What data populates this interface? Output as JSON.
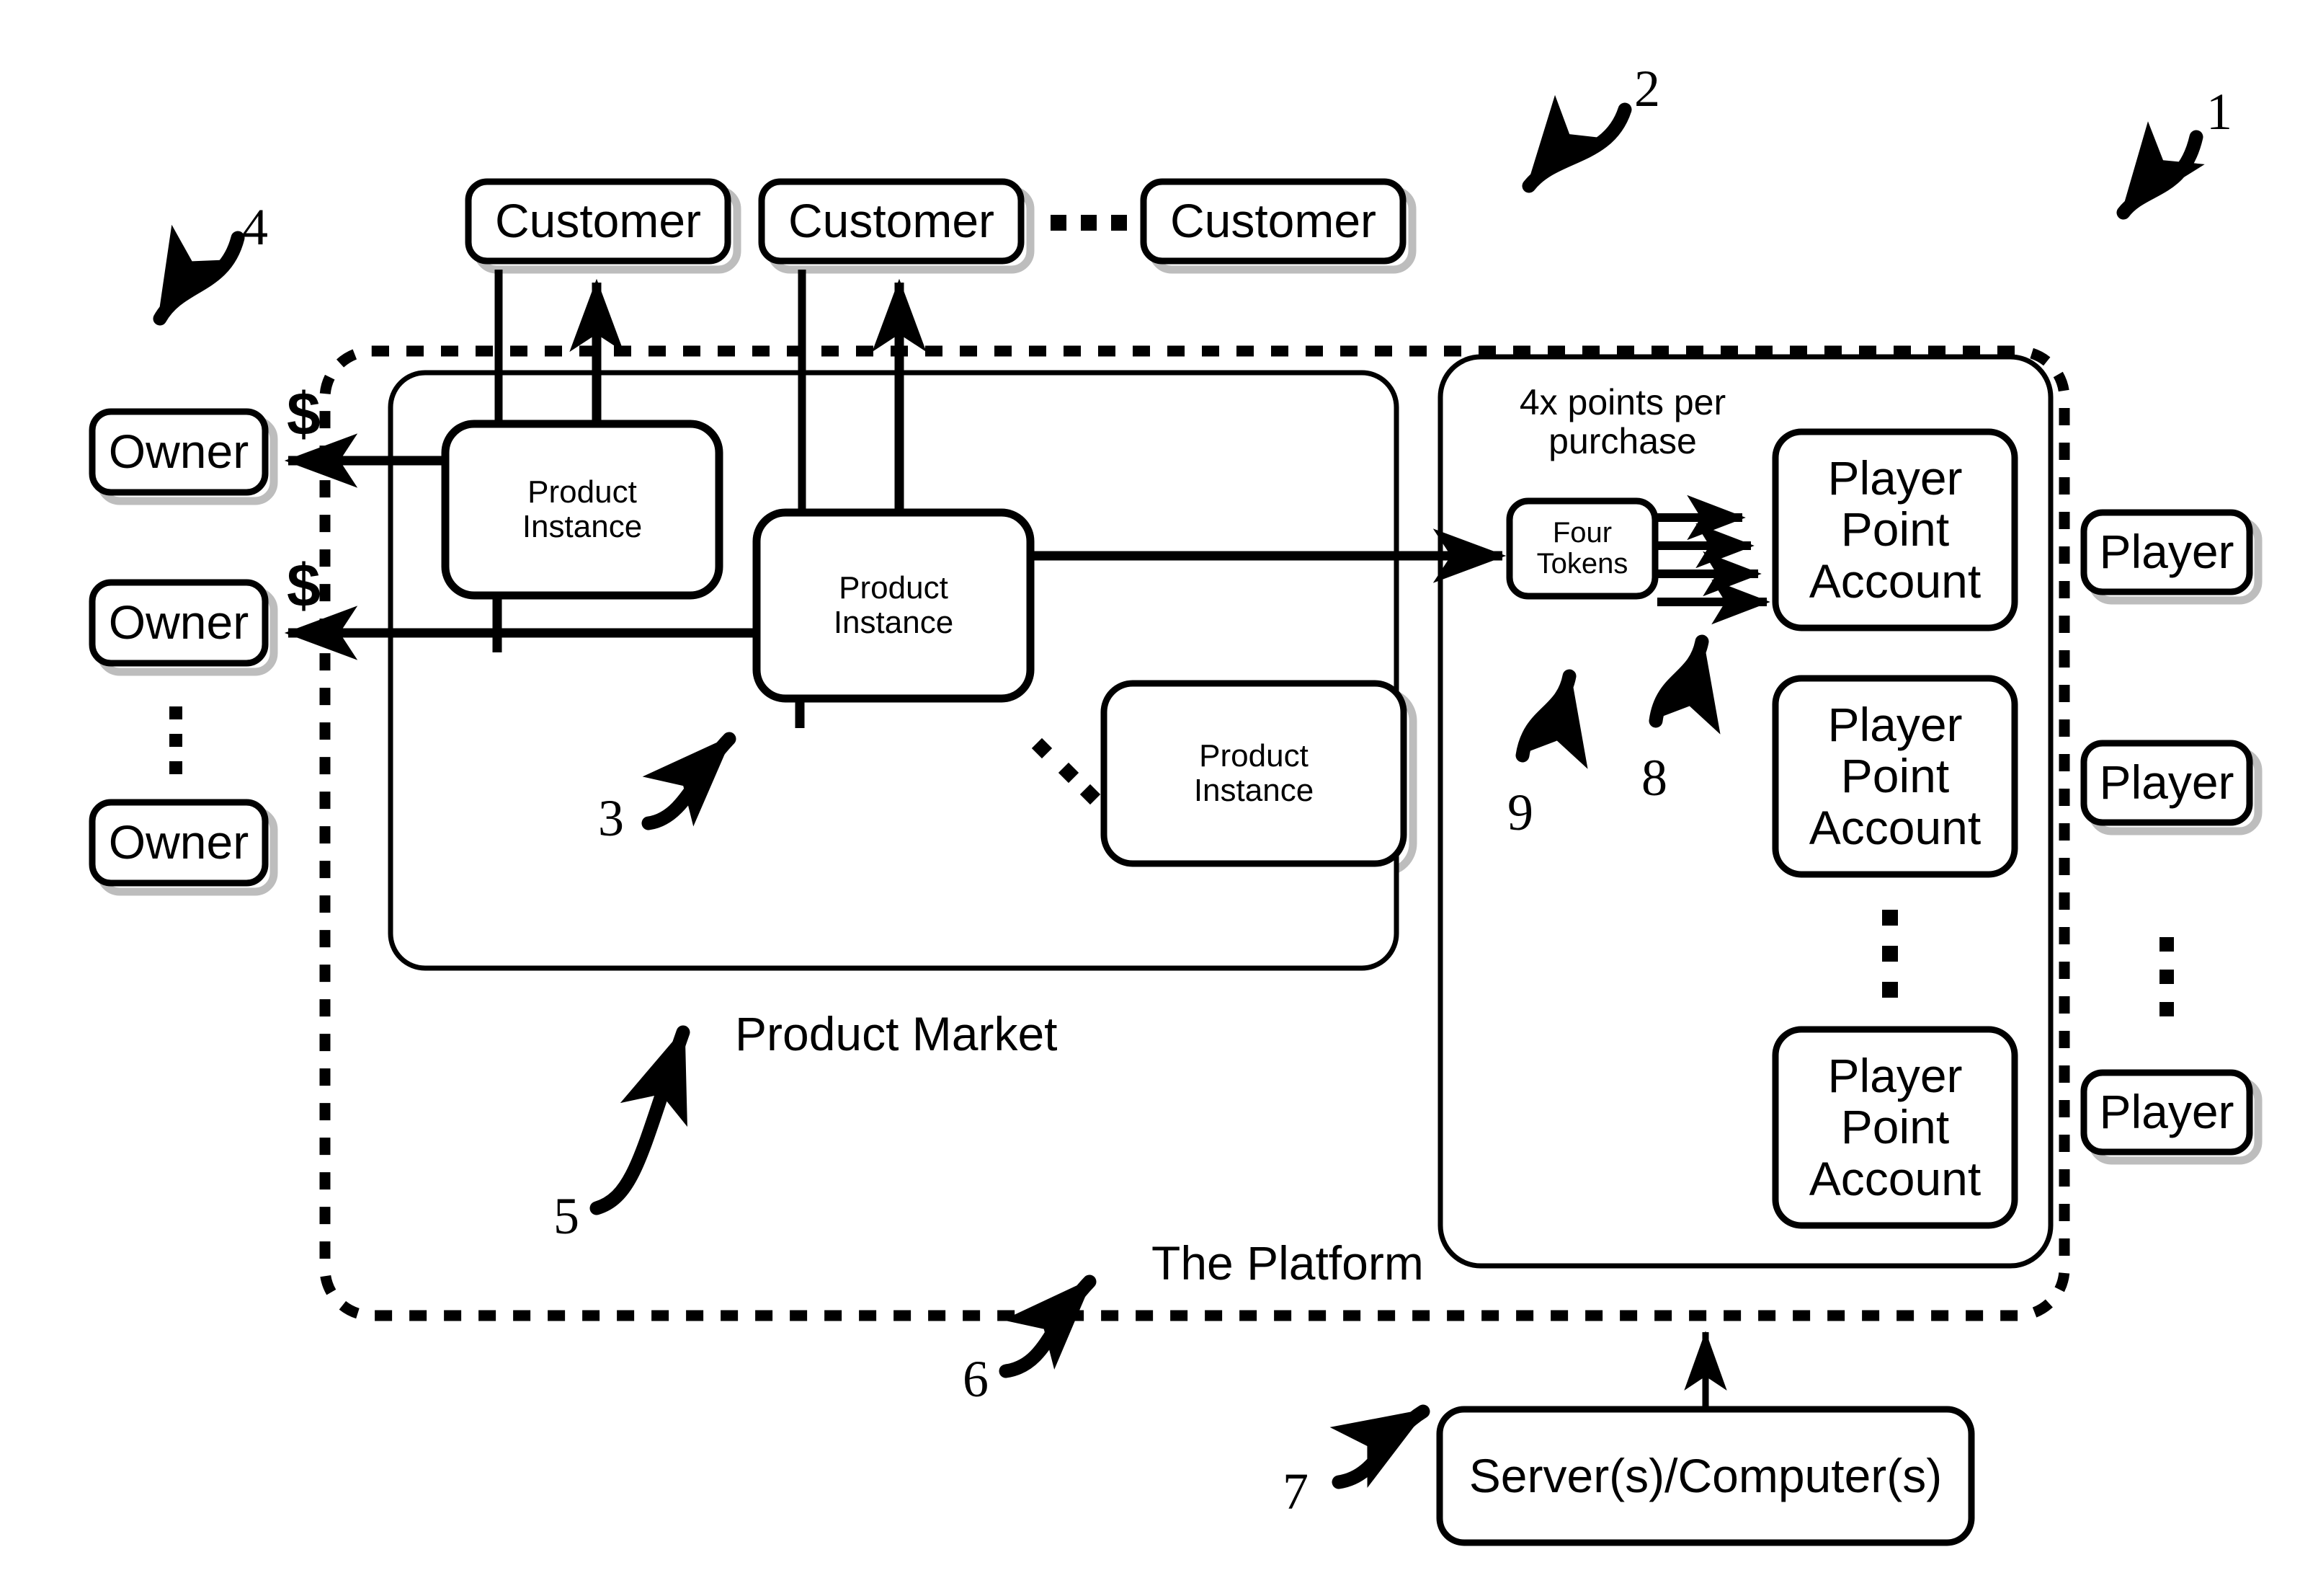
{
  "diagram": {
    "title_labels": {
      "platform": "The Platform",
      "product_market": "Product Market",
      "points_rule": "4x points per purchase"
    },
    "customers": [
      {
        "label": "Customer"
      },
      {
        "label": "Customer"
      },
      {
        "label": "Customer"
      }
    ],
    "customer_ellipsis": "· · ·",
    "owners": [
      {
        "label": "Owner"
      },
      {
        "label": "Owner"
      },
      {
        "label": "Owner"
      }
    ],
    "owner_money_labels": [
      "$",
      "$"
    ],
    "product_instances": [
      {
        "line1": "Product",
        "line2": "Instance"
      },
      {
        "line1": "Product",
        "line2": "Instance"
      },
      {
        "line1": "Product",
        "line2": "Instance"
      }
    ],
    "tokens_box": {
      "line1": "Four",
      "line2": "Tokens"
    },
    "player_point_accounts": [
      {
        "line1": "Player",
        "line2": "Point",
        "line3": "Account"
      },
      {
        "line1": "Player",
        "line2": "Point",
        "line3": "Account"
      },
      {
        "line1": "Player",
        "line2": "Point",
        "line3": "Account"
      }
    ],
    "players": [
      {
        "label": "Player"
      },
      {
        "label": "Player"
      },
      {
        "label": "Player"
      }
    ],
    "server_box": {
      "label": "Server(s)/Computer(s)"
    },
    "reference_numerals": [
      {
        "id": "ref-1",
        "value": "1"
      },
      {
        "id": "ref-2",
        "value": "2"
      },
      {
        "id": "ref-3",
        "value": "3"
      },
      {
        "id": "ref-4",
        "value": "4"
      },
      {
        "id": "ref-5",
        "value": "5"
      },
      {
        "id": "ref-6",
        "value": "6"
      },
      {
        "id": "ref-7",
        "value": "7"
      },
      {
        "id": "ref-8",
        "value": "8"
      },
      {
        "id": "ref-9",
        "value": "9"
      }
    ],
    "colors": {
      "ink": "#000000",
      "paper": "#ffffff",
      "shadow": "#9a9a9a"
    }
  }
}
